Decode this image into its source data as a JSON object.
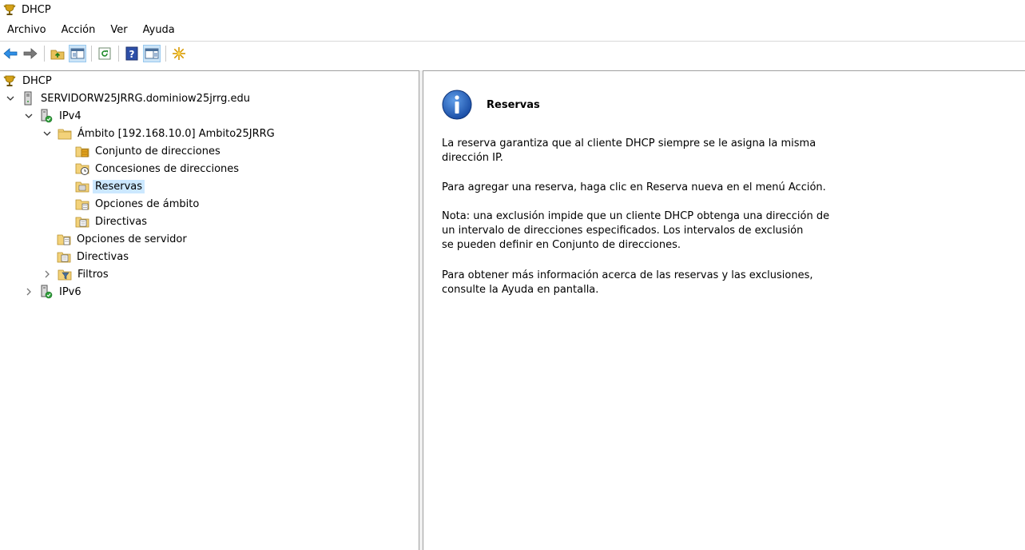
{
  "window": {
    "title": "DHCP",
    "app_icon": "dhcp-trophy-icon"
  },
  "menu": [
    "Archivo",
    "Acción",
    "Ver",
    "Ayuda"
  ],
  "toolbar": {
    "buttons": [
      {
        "name": "back",
        "icon": "back-arrow-icon"
      },
      {
        "name": "forward",
        "icon": "forward-arrow-icon"
      },
      {
        "name": "up-one-level",
        "icon": "folder-up-icon"
      },
      {
        "name": "show-hide-console-tree",
        "icon": "console-tree-icon"
      },
      {
        "name": "refresh",
        "icon": "refresh-icon"
      },
      {
        "name": "help",
        "icon": "help-icon"
      },
      {
        "name": "show-hide-action-pane",
        "icon": "action-pane-icon"
      },
      {
        "name": "new-reservation",
        "icon": "new-star-icon"
      }
    ]
  },
  "tree": {
    "root": {
      "label": "DHCP",
      "icon": "dhcp-trophy-icon"
    },
    "server": {
      "label": "SERVIDORW25JRRG.dominiow25jrrg.edu",
      "icon": "server-icon",
      "expanded": true
    },
    "ipv4": {
      "label": "IPv4",
      "icon": "ipv4-server-icon",
      "expanded": true
    },
    "scope": {
      "label": "Ámbito [192.168.10.0] Ambito25JRRG",
      "icon": "folder-icon",
      "expanded": true
    },
    "scope_children": [
      {
        "label": "Conjunto de direcciones",
        "icon": "address-pool-icon"
      },
      {
        "label": "Concesiones de direcciones",
        "icon": "address-leases-icon"
      },
      {
        "label": "Reservas",
        "icon": "reservations-icon",
        "selected": true
      },
      {
        "label": "Opciones de ámbito",
        "icon": "scope-options-icon"
      },
      {
        "label": "Directivas",
        "icon": "policies-icon"
      }
    ],
    "ipv4_children": [
      {
        "label": "Opciones de servidor",
        "icon": "server-options-icon"
      },
      {
        "label": "Directivas",
        "icon": "policies-icon"
      },
      {
        "label": "Filtros",
        "icon": "filters-icon",
        "expanded": false
      }
    ],
    "ipv6": {
      "label": "IPv6",
      "icon": "ipv6-server-icon",
      "expanded": false
    }
  },
  "detail": {
    "icon": "info-icon",
    "title": "Reservas",
    "paragraphs": [
      [
        "La reserva garantiza que al cliente DHCP siempre se le asigna la misma",
        "dirección IP."
      ],
      [
        "Para agregar una reserva, haga clic en Reserva nueva en el menú Acción."
      ],
      [
        "Nota: una exclusión impide que un cliente DHCP obtenga una dirección de",
        "un intervalo de direcciones especificados. Los intervalos de exclusión",
        "se pueden definir en Conjunto de direcciones."
      ],
      [
        "Para obtener más información acerca de las reservas y las exclusiones,",
        "consulte la Ayuda en pantalla."
      ]
    ]
  },
  "colors": {
    "selection": "#cce8ff",
    "toolbar_pressed": "#cce4f7",
    "info_blue": "#1f5fb8"
  }
}
